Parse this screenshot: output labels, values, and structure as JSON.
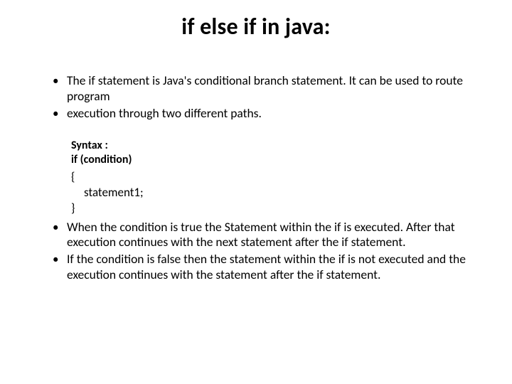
{
  "title": "if else if in java:",
  "bullets": {
    "b1": "The if statement is Java's conditional branch statement. It can be used to route program",
    "b2": "execution through two different paths.",
    "b3": "When the condition is true the Statement within the if is executed. After that execution continues with the next statement after the if statement.",
    "b4": " If the condition is false then the statement within the if is not executed and the execution continues with the statement after the if statement."
  },
  "syntax": {
    "label": "Syntax :",
    "cond": "if (condition)",
    "open": "{",
    "stmt": "statement1;",
    "close": "}"
  }
}
